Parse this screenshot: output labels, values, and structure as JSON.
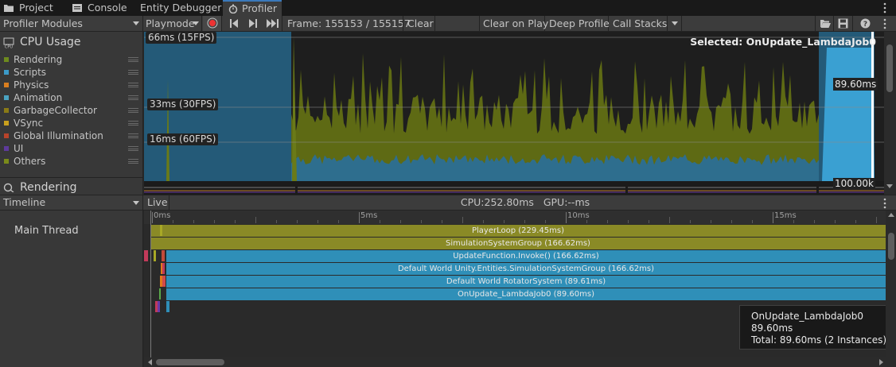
{
  "tabs": [
    {
      "label": "Project",
      "icon": "folder-icon"
    },
    {
      "label": "Console",
      "icon": "console-icon"
    },
    {
      "label": "Entity Debugger",
      "icon": ""
    },
    {
      "label": "Profiler",
      "icon": "stopwatch-icon"
    }
  ],
  "toolbar": {
    "modules_label": "Profiler Modules",
    "playmode_label": "Playmode",
    "frame_label": "Frame: 155153 / 155157",
    "clear_label": "Clear",
    "clear_on_play_label": "Clear on Play",
    "deep_profile_label": "Deep Profile",
    "call_stacks_label": "Call Stacks"
  },
  "cpu_module": {
    "title": "CPU Usage",
    "legend": [
      {
        "label": "Rendering",
        "color": "#6e8a1e"
      },
      {
        "label": "Scripts",
        "color": "#3c9bc9"
      },
      {
        "label": "Physics",
        "color": "#d97e1f"
      },
      {
        "label": "Animation",
        "color": "#4aa3c1"
      },
      {
        "label": "GarbageCollector",
        "color": "#8a7a16"
      },
      {
        "label": "VSync",
        "color": "#c9a01e"
      },
      {
        "label": "Global Illumination",
        "color": "#b8432a"
      },
      {
        "label": "UI",
        "color": "#5e3a9c"
      },
      {
        "label": "Others",
        "color": "#7a8b1a"
      }
    ]
  },
  "rendering_module": {
    "title": "Rendering"
  },
  "chart": {
    "label_66": "66ms (15FPS)",
    "label_33": "33ms (30FPS)",
    "label_16": "16ms (60FPS)",
    "selected_label": "Selected: OnUpdate_LambdaJob0",
    "selected_value": "89.60ms",
    "rendering_value": "100.00k"
  },
  "timeline": {
    "view_label": "Timeline",
    "live_label": "Live",
    "cpu_gpu": "CPU:252.80ms   GPU:--ms",
    "thread_label": "Main Thread",
    "ticks": [
      "0ms",
      "5ms",
      "10ms",
      "15ms"
    ],
    "bars": [
      {
        "label": "PlayerLoop (229.45ms)",
        "color": "#8a8a26"
      },
      {
        "label": "SimulationSystemGroup (166.62ms)",
        "color": "#8a8a26"
      },
      {
        "label": "UpdateFunction.Invoke() (166.62ms)",
        "color": "#2f8fb8"
      },
      {
        "label": "Default World Unity.Entities.SimulationSystemGroup (166.62ms)",
        "color": "#2f8fb8"
      },
      {
        "label": "Default World RotatorSystem (89.61ms)",
        "color": "#2f8fb8"
      },
      {
        "label": "OnUpdate_LambdaJob0 (89.60ms)",
        "color": "#2f8fb8"
      }
    ]
  },
  "tooltip": {
    "line1": "OnUpdate_LambdaJob0",
    "line2": "89.60ms",
    "line3": "Total: 89.60ms (2 Instances)"
  }
}
